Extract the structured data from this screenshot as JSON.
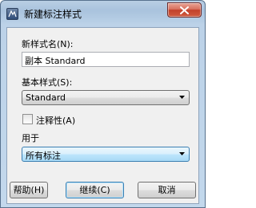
{
  "window": {
    "title": "新建标注样式",
    "icon": "autocad-app-icon",
    "close_icon": "close-icon"
  },
  "form": {
    "new_style_name_label": "新样式名(N):",
    "new_style_name_value": "副本 Standard",
    "base_style_label": "基本样式(S):",
    "base_style_value": "Standard",
    "annotative_label": "注释性(A)",
    "annotative_checked": false,
    "use_for_label": "用于",
    "use_for_value": "所有标注"
  },
  "buttons": {
    "help": "帮助(H)",
    "continue": "继续(C)",
    "cancel": "取消"
  }
}
